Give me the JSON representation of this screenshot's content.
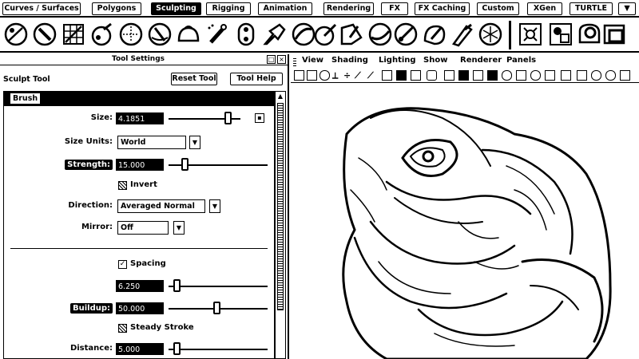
{
  "shelf": {
    "tabs": [
      "Curves / Surfaces",
      "Polygons",
      "Sculpting",
      "Rigging",
      "Animation",
      "Rendering",
      "FX",
      "FX Caching",
      "Custom",
      "XGen",
      "TURTLE"
    ],
    "active_tab": "Sculpting",
    "tools": [
      "sculpt-brush",
      "smooth-brush",
      "relax-brush",
      "grab-brush",
      "pinch-brush",
      "flatten-brush",
      "foamy-brush",
      "spray-brush",
      "repeat-brush",
      "imprint-brush",
      "wax-brush",
      "scrape-brush",
      "fill-brush",
      "knife-brush",
      "smear-brush",
      "bulge-brush",
      "amplify-brush",
      "freeze-brush",
      "convert-to-frozen",
      "mask-tool",
      "unfreeze-tool",
      "bake-tool"
    ]
  },
  "tool_panel": {
    "title": "Tool Settings",
    "tool_name": "Sculpt Tool",
    "reset_label": "Reset Tool",
    "help_label": "Tool Help",
    "section_brush": "Brush",
    "size": {
      "label": "Size:",
      "value": "4.1851",
      "fraction": 0.95
    },
    "size_units": {
      "label": "Size Units:",
      "value": "World"
    },
    "strength": {
      "label": "Strength:",
      "value": "15.000",
      "fraction": 0.15
    },
    "invert_label": "Invert",
    "direction": {
      "label": "Direction:",
      "value": "Averaged Normal"
    },
    "mirror": {
      "label": "Mirror:",
      "value": "Off"
    },
    "spacing_label": "Spacing",
    "spacing_value": "6.250",
    "spacing_fraction": 0.06,
    "buildup": {
      "label": "Buildup:",
      "value": "50.000",
      "fraction": 0.5
    },
    "steady_label": "Steady Stroke",
    "distance": {
      "label": "Distance:",
      "value": "5.000"
    }
  },
  "viewport": {
    "menu": [
      "View",
      "Shading",
      "Lighting",
      "Show",
      "Renderer",
      "Panels"
    ]
  }
}
